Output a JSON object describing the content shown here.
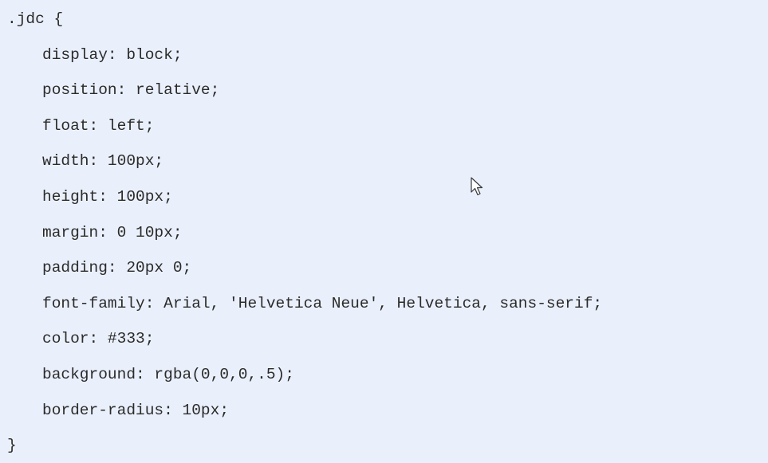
{
  "code": {
    "selector_line": ".jdc {",
    "declarations": [
      "display: block;",
      "position: relative;",
      "float: left;",
      "width: 100px;",
      "height: 100px;",
      "margin: 0 10px;",
      "padding: 20px 0;",
      "font-family: Arial, 'Helvetica Neue', Helvetica, sans-serif;",
      "color: #333;",
      "background: rgba(0,0,0,.5);",
      "border-radius: 10px;"
    ],
    "closing_line": "}"
  },
  "colors": {
    "background": "#eaf0fb",
    "text": "#2b2b2b"
  },
  "cursor": {
    "icon": "mouse-pointer-icon"
  }
}
